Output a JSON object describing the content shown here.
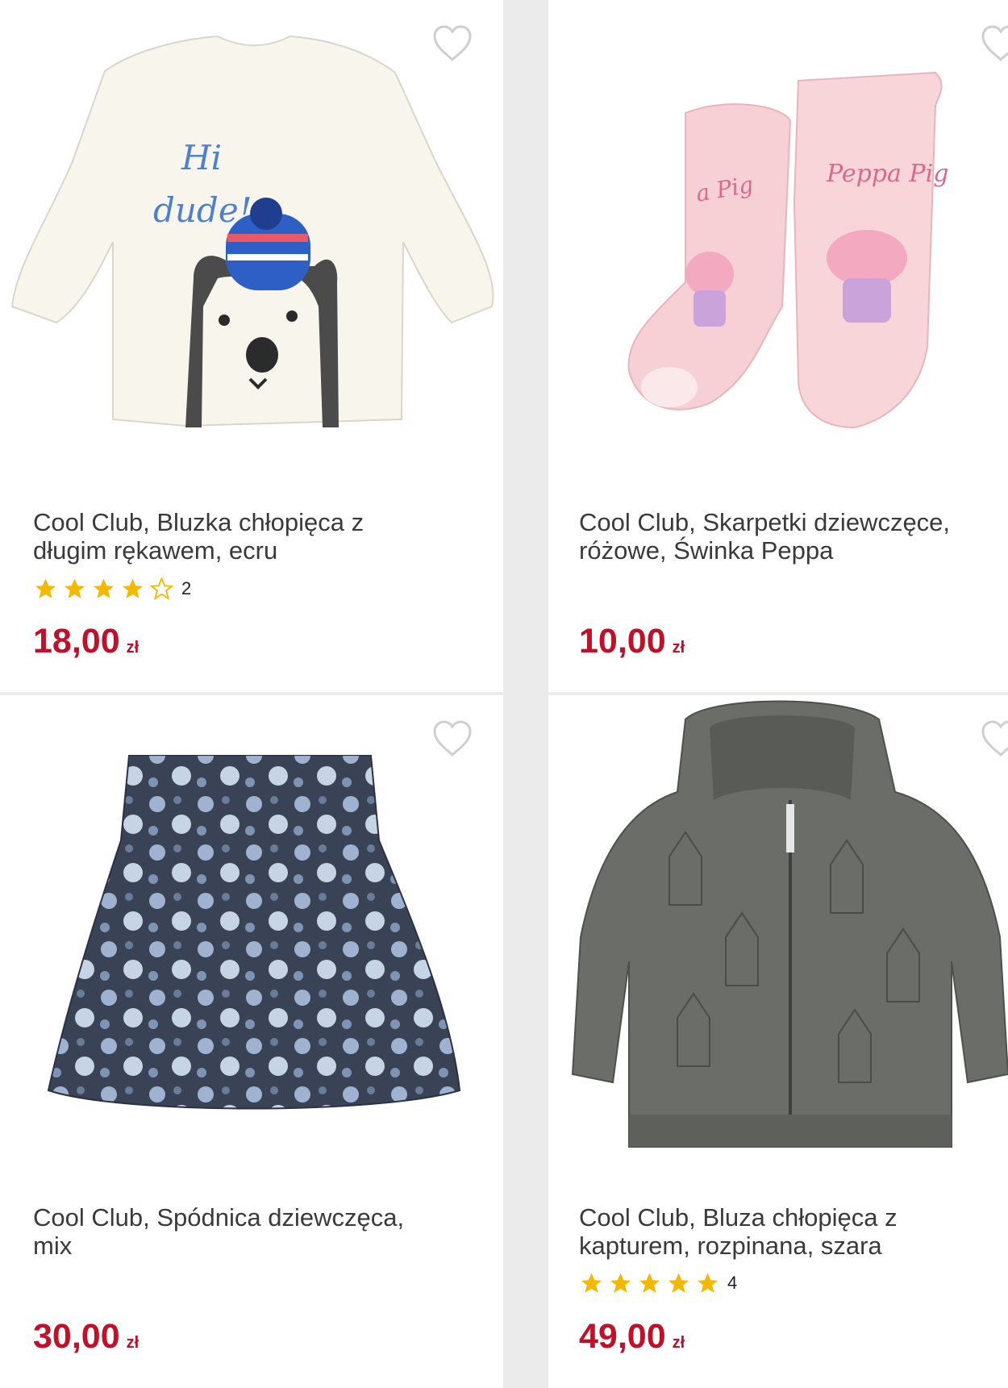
{
  "products": [
    {
      "title": "Cool Club, Bluzka chłopięca z długim rękawem, ecru",
      "rating_stars": 4,
      "rating_count": "2",
      "price": "18,00",
      "currency": "zł",
      "image_text_1": "Hi",
      "image_text_2": "dude!",
      "image_icon": "shirt-image"
    },
    {
      "title": "Cool Club, Skarpetki dziewczęce, różowe, Świnka Peppa",
      "rating_count": "",
      "price": "10,00",
      "currency": "zł",
      "image_text_1": "Peppa Pig",
      "image_text_2": "a Pig",
      "image_icon": "socks-image"
    },
    {
      "title": "Cool Club, Spódnica dziewczęca, mix",
      "rating_count": "",
      "price": "30,00",
      "currency": "zł",
      "image_icon": "skirt-image"
    },
    {
      "title": "Cool Club, Bluza chłopięca z kapturem, rozpinana, szara",
      "rating_stars": 5,
      "rating_count": "4",
      "price": "49,00",
      "currency": "zł",
      "image_icon": "hoodie-image"
    }
  ],
  "colors": {
    "price": "#c0102a",
    "star": "#f5b800",
    "background": "#ebebeb"
  }
}
